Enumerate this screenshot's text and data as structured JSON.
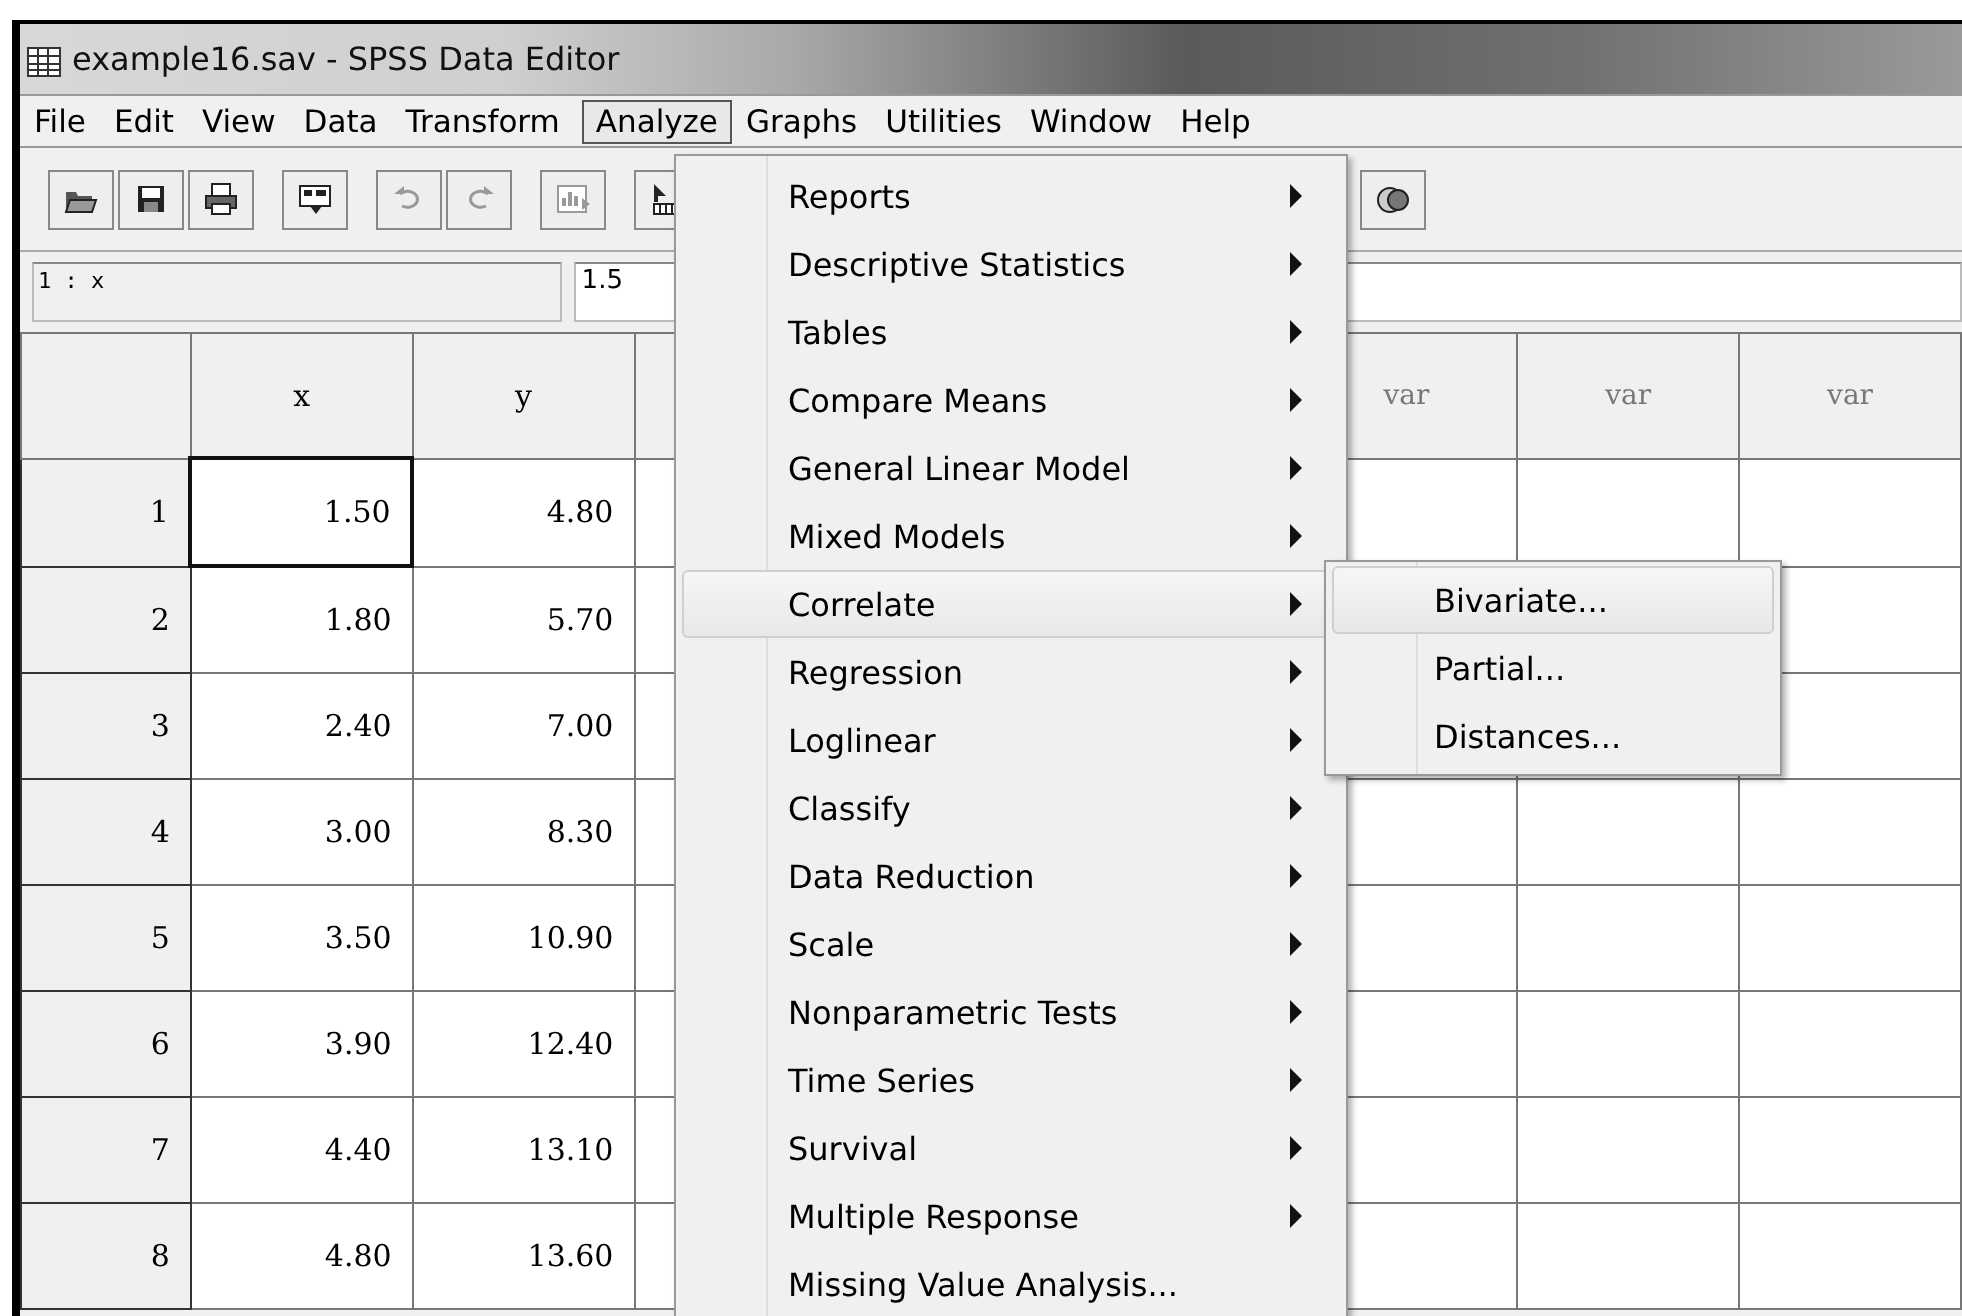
{
  "window": {
    "title": "example16.sav - SPSS Data Editor"
  },
  "menu_bar": [
    {
      "label": "File",
      "selected": false
    },
    {
      "label": "Edit",
      "selected": false
    },
    {
      "label": "View",
      "selected": false
    },
    {
      "label": "Data",
      "selected": false
    },
    {
      "label": "Transform",
      "selected": false
    },
    {
      "label": "Analyze",
      "selected": true
    },
    {
      "label": "Graphs",
      "selected": false
    },
    {
      "label": "Utilities",
      "selected": false
    },
    {
      "label": "Window",
      "selected": false
    },
    {
      "label": "Help",
      "selected": false
    }
  ],
  "cell_editor": {
    "cell_ref": "1 : x",
    "value": "1.5"
  },
  "table": {
    "columns": [
      {
        "kind": "header",
        "label": "x"
      },
      {
        "kind": "header",
        "label": "y"
      },
      {
        "kind": "covered"
      },
      {
        "kind": "header",
        "label": "var"
      },
      {
        "kind": "header",
        "label": "var"
      },
      {
        "kind": "header",
        "label": "var"
      }
    ],
    "rows": [
      {
        "number": "1",
        "cells": [
          {
            "value": "1.50",
            "selected": true
          },
          {
            "value": "4.80",
            "selected": false
          }
        ]
      },
      {
        "number": "2",
        "cells": [
          {
            "value": "1.80",
            "selected": false
          },
          {
            "value": "5.70",
            "selected": false
          }
        ]
      },
      {
        "number": "3",
        "cells": [
          {
            "value": "2.40",
            "selected": false
          },
          {
            "value": "7.00",
            "selected": false
          }
        ]
      },
      {
        "number": "4",
        "cells": [
          {
            "value": "3.00",
            "selected": false
          },
          {
            "value": "8.30",
            "selected": false
          }
        ]
      },
      {
        "number": "5",
        "cells": [
          {
            "value": "3.50",
            "selected": false
          },
          {
            "value": "10.90",
            "selected": false
          }
        ]
      },
      {
        "number": "6",
        "cells": [
          {
            "value": "3.90",
            "selected": false
          },
          {
            "value": "12.40",
            "selected": false
          }
        ]
      },
      {
        "number": "7",
        "cells": [
          {
            "value": "4.40",
            "selected": false
          },
          {
            "value": "13.10",
            "selected": false
          }
        ]
      },
      {
        "number": "8",
        "cells": [
          {
            "value": "4.80",
            "selected": false
          },
          {
            "value": "13.60",
            "selected": false
          }
        ]
      }
    ]
  },
  "analyze_menu": {
    "items": [
      {
        "label": "Reports",
        "submenu": true,
        "selected": false
      },
      {
        "label": "Descriptive Statistics",
        "submenu": true,
        "selected": false
      },
      {
        "label": "Tables",
        "submenu": true,
        "selected": false
      },
      {
        "label": "Compare Means",
        "submenu": true,
        "selected": false
      },
      {
        "label": "General Linear Model",
        "submenu": true,
        "selected": false
      },
      {
        "label": "Mixed Models",
        "submenu": true,
        "selected": false
      },
      {
        "label": "Correlate",
        "submenu": true,
        "selected": true
      },
      {
        "label": "Regression",
        "submenu": true,
        "selected": false
      },
      {
        "label": "Loglinear",
        "submenu": true,
        "selected": false
      },
      {
        "label": "Classify",
        "submenu": true,
        "selected": false
      },
      {
        "label": "Data Reduction",
        "submenu": true,
        "selected": false
      },
      {
        "label": "Scale",
        "submenu": true,
        "selected": false
      },
      {
        "label": "Nonparametric Tests",
        "submenu": true,
        "selected": false
      },
      {
        "label": "Time Series",
        "submenu": true,
        "selected": false
      },
      {
        "label": "Survival",
        "submenu": true,
        "selected": false
      },
      {
        "label": "Multiple Response",
        "submenu": true,
        "selected": false
      },
      {
        "label": "Missing Value Analysis...",
        "submenu": false,
        "selected": false
      }
    ]
  },
  "correlate_submenu": {
    "items": [
      {
        "label": "Bivariate...",
        "selected": true
      },
      {
        "label": "Partial...",
        "selected": false
      },
      {
        "label": "Distances...",
        "selected": false
      }
    ]
  }
}
